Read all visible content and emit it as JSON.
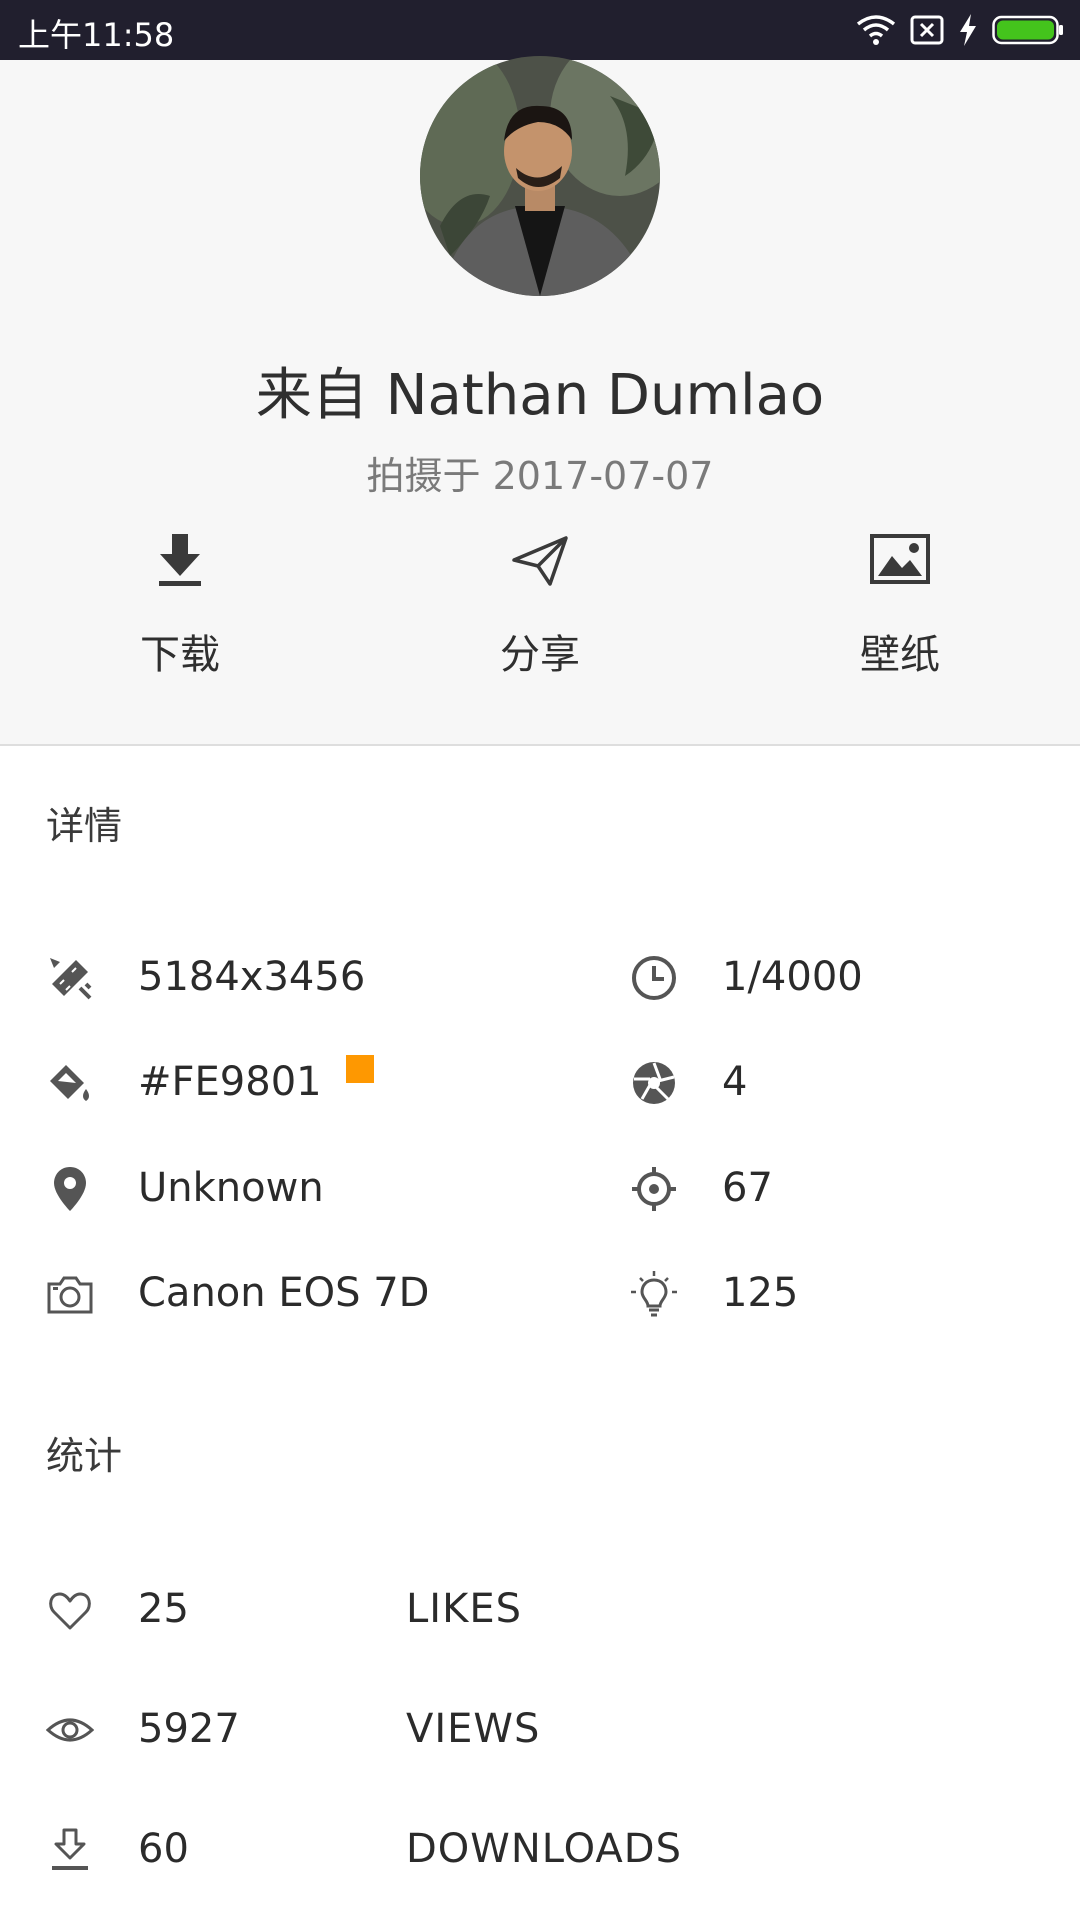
{
  "status_bar": {
    "time": "上午11:58",
    "icons": [
      "wifi-icon",
      "sim-x-icon",
      "charging-icon",
      "battery-icon"
    ],
    "battery_color": "#44c41c"
  },
  "header": {
    "title": "来自 Nathan Dumlao",
    "subtitle": "拍摄于 2017-07-07"
  },
  "actions": [
    {
      "label": "下载",
      "icon": "download-icon"
    },
    {
      "label": "分享",
      "icon": "share-icon"
    },
    {
      "label": "壁纸",
      "icon": "wallpaper-icon"
    }
  ],
  "details": {
    "heading": "详情",
    "resolution": "5184x3456",
    "color": "#FE9801",
    "swatch_color": "#FE9801",
    "location": "Unknown",
    "camera": "Canon EOS 7D",
    "exposure": "1/4000",
    "aperture": "4",
    "focal": "67",
    "iso": "125"
  },
  "stats": {
    "heading": "统计",
    "items": [
      {
        "count": "25",
        "label": "LIKES",
        "icon": "heart-icon"
      },
      {
        "count": "5927",
        "label": "VIEWS",
        "icon": "eye-icon"
      },
      {
        "count": "60",
        "label": "DOWNLOADS",
        "icon": "download-outline-icon"
      }
    ]
  }
}
